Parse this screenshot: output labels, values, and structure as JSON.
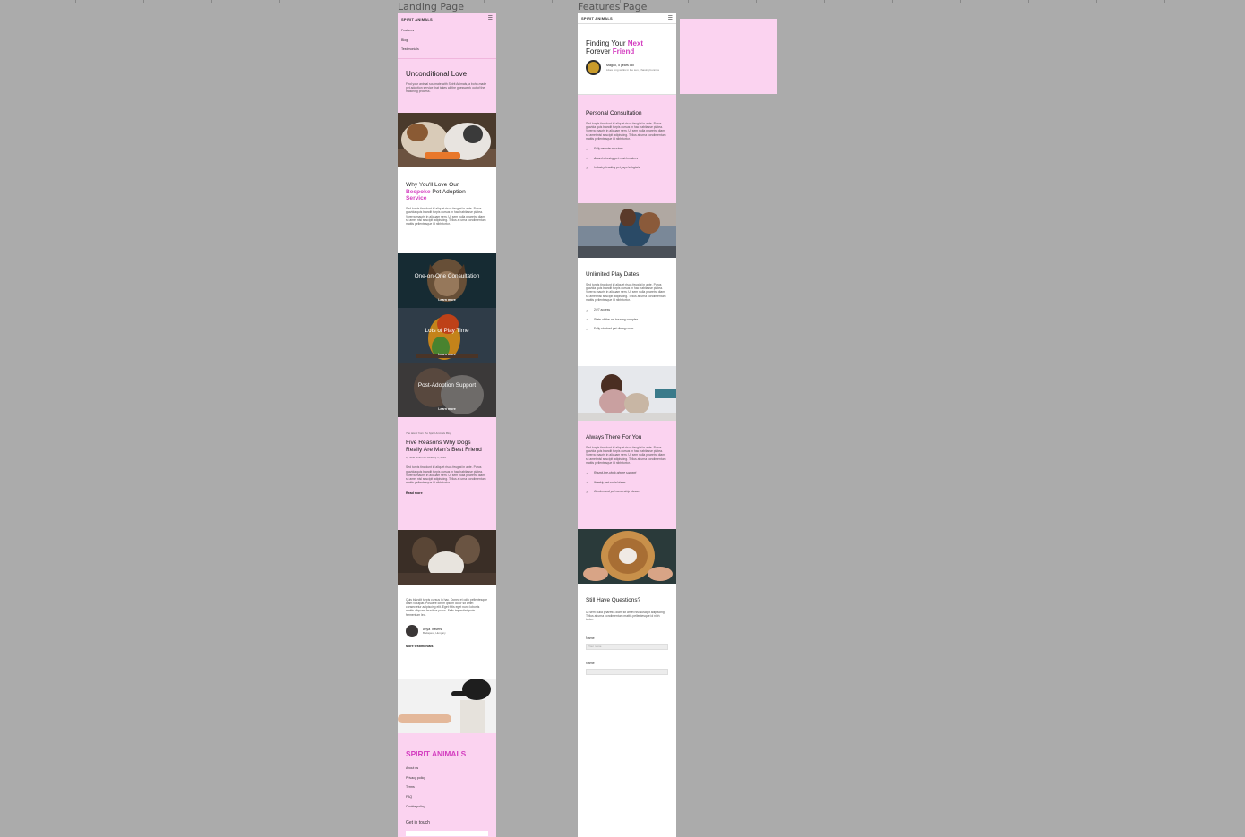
{
  "frames": {
    "landing_title": "Landing Page",
    "features_title": "Features Page"
  },
  "landing": {
    "brand": "SPIRIT ANIMALS",
    "nav": [
      "Features",
      "Blog",
      "Testimonials"
    ],
    "hero": {
      "title": "Unconditional Love",
      "text": "Find your animal soulmate with Spirit Animals, a boho-made pet adoption service that takes all the guesswork out of the matching process."
    },
    "why": {
      "title_a": "Why You'll Love Our",
      "title_accent": "Bespoke",
      "title_b": "Pet Adoption",
      "title_accent2": "Service",
      "text": "Sed turpis tincidunt id aliquet risus feugiat in ante. Purus gravida quis blandit turpis cursus in hac habitasse platea. Viverra mauris in aliquam sem. Ut sem nulla pharetra diam sit amet nisl suscipit adipiscing. Tellus at urna condimentum mattis pellentesque id nibh tortor."
    },
    "cards": [
      {
        "title": "One-on-One Consultation",
        "link": "Learn more"
      },
      {
        "title": "Lots of Play Time",
        "link": "Learn more"
      },
      {
        "title": "Post-Adoption Support",
        "link": "Learn more"
      }
    ],
    "blog": {
      "kicker": "The latest from the Spirit Animals Blog",
      "title": "Five Reasons Why Dogs Really Are Man's Best Friend",
      "byline": "by Julie Smith on January 1, 2020",
      "text": "Sed turpis tincidunt id aliquet risus feugiat in ante. Purus gravida quis blandit turpis cursus in hac habitasse platea. Viverra mauris in aliquam sem. Ut sem nulla pharetra diam sit amet nisl suscipit adipiscing. Tellus at urna condimentum mattis pellentesque id nibh tortor.",
      "link": "Read more"
    },
    "testimonial": {
      "text": "Quis blandit turpis cursus in hac. Donec et odio pellentesque diam volutpat. Posuere lorem ipsum dolor sit amet consectetur adipiscing elit. Eget felis eget nunc lobortis mattis aliquam faucibus purus. Felis imperdiet proin fermentum leo.",
      "name": "Anya Travers",
      "location": "Budapest, Hungary",
      "link": "More testimonials"
    },
    "footer": {
      "brand": "SPIRIT ANIMALS",
      "links": [
        "About us",
        "Privacy policy",
        "Terms",
        "FAQ",
        "Cookie policy"
      ],
      "contact": "Get in touch"
    }
  },
  "features": {
    "brand": "SPIRIT ANIMALS",
    "hero": {
      "title_a": "Finding Your",
      "title_accent": "Next",
      "title_b": "Forever",
      "title_accent2": "Friend",
      "pet_name": "Magoo, 5 years old",
      "pet_desc": "Likes long walks in the sun, chasing bunnies"
    },
    "sections": [
      {
        "title": "Personal Consultation",
        "text": "Sed turpis tincidunt id aliquet risus feugiat in ante. Purus gravida quis blandit turpis cursus in hac habitasse platea. Viverra mauris in aliquam sem. Ut sem nulla pharetra diam sit amet nisl suscipit adipiscing. Tellus at urna condimentum mattis pellentesque id nibh tortor.",
        "items": [
          "Fully remote sessions",
          "Award-winning pet matchmakers",
          "Industry-leading pet psychologists"
        ]
      },
      {
        "title": "Unlimited Play Dates",
        "text": "Sed turpis tincidunt id aliquet risus feugiat in ante. Purus gravida quis blandit turpis cursus in hac habitasse platea. Viverra mauris in aliquam sem. Ut sem nulla pharetra diam sit amet nisl suscipit adipiscing. Tellus at urna condimentum mattis pellentesque id nibh tortor.",
        "items": [
          "24/7 access",
          "State-of-the-art housing complex",
          "Fully-stocked pet dining room"
        ]
      },
      {
        "title": "Always There For You",
        "text": "Sed turpis tincidunt id aliquet risus feugiat in ante. Purus gravida quis blandit turpis cursus in hac habitasse platea. Viverra mauris in aliquam sem. Ut sem nulla pharetra diam sit amet nisl suscipit adipiscing. Tellus at urna condimentum mattis pellentesque id nibh tortor.",
        "items": [
          "Round-the-clock phone support",
          "Weekly pet social dates",
          "On-demand pet ownership classes"
        ]
      }
    ],
    "questions": {
      "title": "Still Have Questions?",
      "text": "Ut sem nulla pharetra diam sit amet nisl suscipit adipiscing. Tellus at urna condimentum mattis pellentesque id nibh tortor.",
      "field1_label": "Name",
      "field1_placeholder": "Your name",
      "field2_label": "Name"
    }
  },
  "colors": {
    "pink": "#fbd3f0",
    "accent": "#d43fc0",
    "canvas": "#ababab"
  }
}
